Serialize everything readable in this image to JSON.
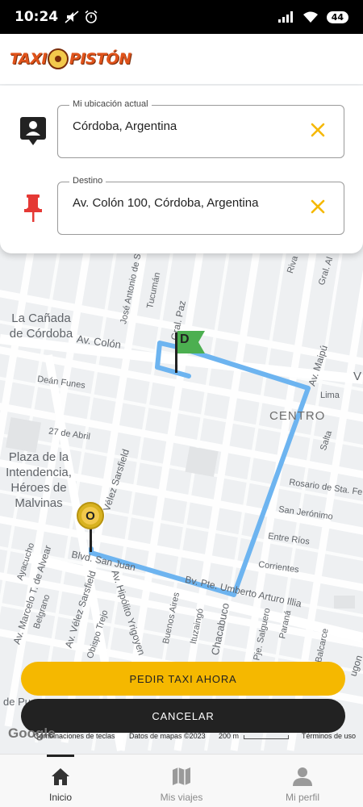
{
  "status_bar": {
    "time": "10:24",
    "battery": "44"
  },
  "header": {
    "logo_text_left": "TAXI",
    "logo_text_right": "PISTÓN"
  },
  "origin": {
    "label": "Mi ubicación actual",
    "value": "Córdoba, Argentina"
  },
  "destination": {
    "label": "Destino",
    "value": "Av. Colón 100, Córdoba, Argentina"
  },
  "map": {
    "places": {
      "canada": "La Cañada de Córdoba",
      "plaza": "Plaza de la Intendencia, Héroes de Malvinas",
      "centro": "CENTRO"
    },
    "streets": {
      "av_colon": "Av. Colón",
      "dean_funes": "Deán Funes",
      "27_abril": "27 de Abril",
      "jose_antonio": "José Antonio de S",
      "tucuman": "Tucumán",
      "gral_paz": "Gral. Paz",
      "av_maipu": "Av. Maipú",
      "lima": "Lima",
      "salta": "Salta",
      "rosario": "Rosario de Sta. Fe",
      "san_jeronimo": "San Jerónimo",
      "entre_rios": "Entre Ríos",
      "corrientes": "Corrientes",
      "velez": "Vélez Sarsfield",
      "blvd_san_juan": "Blvd. San Juan",
      "bv_illia": "Bv. Pte. Umberto Arturo Illia",
      "ayacucho": "Ayacucho",
      "av_alvear": "Av. Marcelo T. de Alvear",
      "belgrano": "Belgrano",
      "av_velez": "Av. Vélez Sarsfield",
      "obispo_trejo": "Obispo Trejo",
      "av_hipolito": "Av. Hipólito Yrigoyen",
      "buenos_aires": "Buenos Aires",
      "ituzaingo": "Ituzaingó",
      "chacabuco": "Chacabuco",
      "pje_salguero": "Pje. Salguero",
      "parana": "Paraná",
      "balcarce": "Balcarce",
      "rivadavia": "Riva",
      "gral_alvear": "Gral. Al",
      "de_pu": "de Pu",
      "v": "V",
      "ugon": "ugon"
    },
    "origin_marker": "O",
    "destination_marker": "D"
  },
  "buttons": {
    "request_taxi": "PEDIR TAXI AHORA",
    "cancel": "CANCELAR"
  },
  "attribution": {
    "google": "Google",
    "shortcuts": "Combinaciones de teclas",
    "map_data": "Datos de mapas ©2023",
    "scale": "200 m",
    "terms": "Términos de uso"
  },
  "bottom_nav": [
    {
      "label": "Inicio",
      "icon": "home-icon",
      "active": true
    },
    {
      "label": "Mis viajes",
      "icon": "map-icon",
      "active": false
    },
    {
      "label": "Mi perfil",
      "icon": "person-icon",
      "active": false
    }
  ],
  "colors": {
    "accent": "#F5B800",
    "route": "#6DB4F0",
    "dest_flag": "#4CAF50",
    "pin_red": "#E53935"
  }
}
